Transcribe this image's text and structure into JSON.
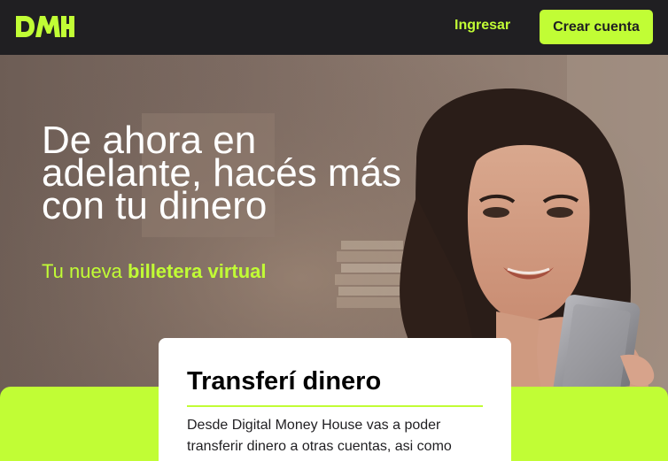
{
  "navbar": {
    "logo_text": "DMH",
    "login_label": "Ingresar",
    "signup_label": "Crear cuenta"
  },
  "hero": {
    "title": "De ahora en adelante, hacés más con tu dinero",
    "subtitle_prefix": "Tu nueva ",
    "subtitle_highlight": "billetera virtual"
  },
  "card": {
    "title": "Transferí dinero",
    "body": "Desde Digital Money House vas a poder transferir dinero a otras cuentas, asi como"
  },
  "colors": {
    "dark": "#201f22",
    "accent": "#c1fd35",
    "white": "#ffffff"
  },
  "icons": {
    "logo": "dmh-logo"
  }
}
